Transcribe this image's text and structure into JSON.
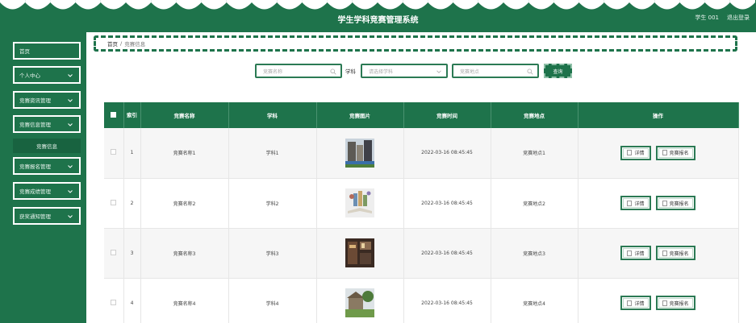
{
  "header": {
    "title": "学生学科竞赛管理系统",
    "user": "学生 001",
    "logout": "退出登录"
  },
  "sidebar": {
    "items": [
      {
        "label": "首页",
        "has_chevron": false
      },
      {
        "label": "个人中心",
        "has_chevron": true
      },
      {
        "label": "竞赛资讯管理",
        "has_chevron": true
      },
      {
        "label": "竞赛信息管理",
        "has_chevron": true
      },
      {
        "label": "竞赛报名管理",
        "has_chevron": true
      },
      {
        "label": "竞赛成绩管理",
        "has_chevron": true
      },
      {
        "label": "获奖通知管理",
        "has_chevron": true
      }
    ],
    "submenu": {
      "label": "竞赛信息"
    }
  },
  "breadcrumb": {
    "home": "首页",
    "separator": "/",
    "current": "竞赛信息"
  },
  "search": {
    "name_placeholder": "竞赛名称",
    "subject_label": "学科",
    "subject_placeholder": "请选择学科",
    "location_placeholder": "竞赛地点",
    "button": "查询"
  },
  "table": {
    "headers": {
      "index": "索引",
      "name": "竞赛名称",
      "subject": "学科",
      "image": "竞赛图片",
      "time": "竞赛时间",
      "location": "竞赛地点",
      "actions": "操作"
    },
    "detail_label": "详情",
    "signup_label": "竞赛报名",
    "rows": [
      {
        "index": "1",
        "name": "竞赛名称1",
        "subject": "学科1",
        "image": "city-street-photo",
        "time": "2022-03-16 08:45:45",
        "location": "竞赛地点1"
      },
      {
        "index": "2",
        "name": "竞赛名称2",
        "subject": "学科2",
        "image": "open-book-illustration",
        "time": "2022-03-16 08:45:45",
        "location": "竞赛地点2"
      },
      {
        "index": "3",
        "name": "竞赛名称3",
        "subject": "学科3",
        "image": "dorm-room-photo",
        "time": "2022-03-16 08:45:45",
        "location": "竞赛地点3"
      },
      {
        "index": "4",
        "name": "竞赛名称4",
        "subject": "学科4",
        "image": "building-garden-photo",
        "time": "2022-03-16 08:45:45",
        "location": "竞赛地点4"
      }
    ]
  },
  "colors": {
    "primary": "#1e734b",
    "header_text": "#ffffff",
    "row_alt": "#f6f6f6"
  }
}
